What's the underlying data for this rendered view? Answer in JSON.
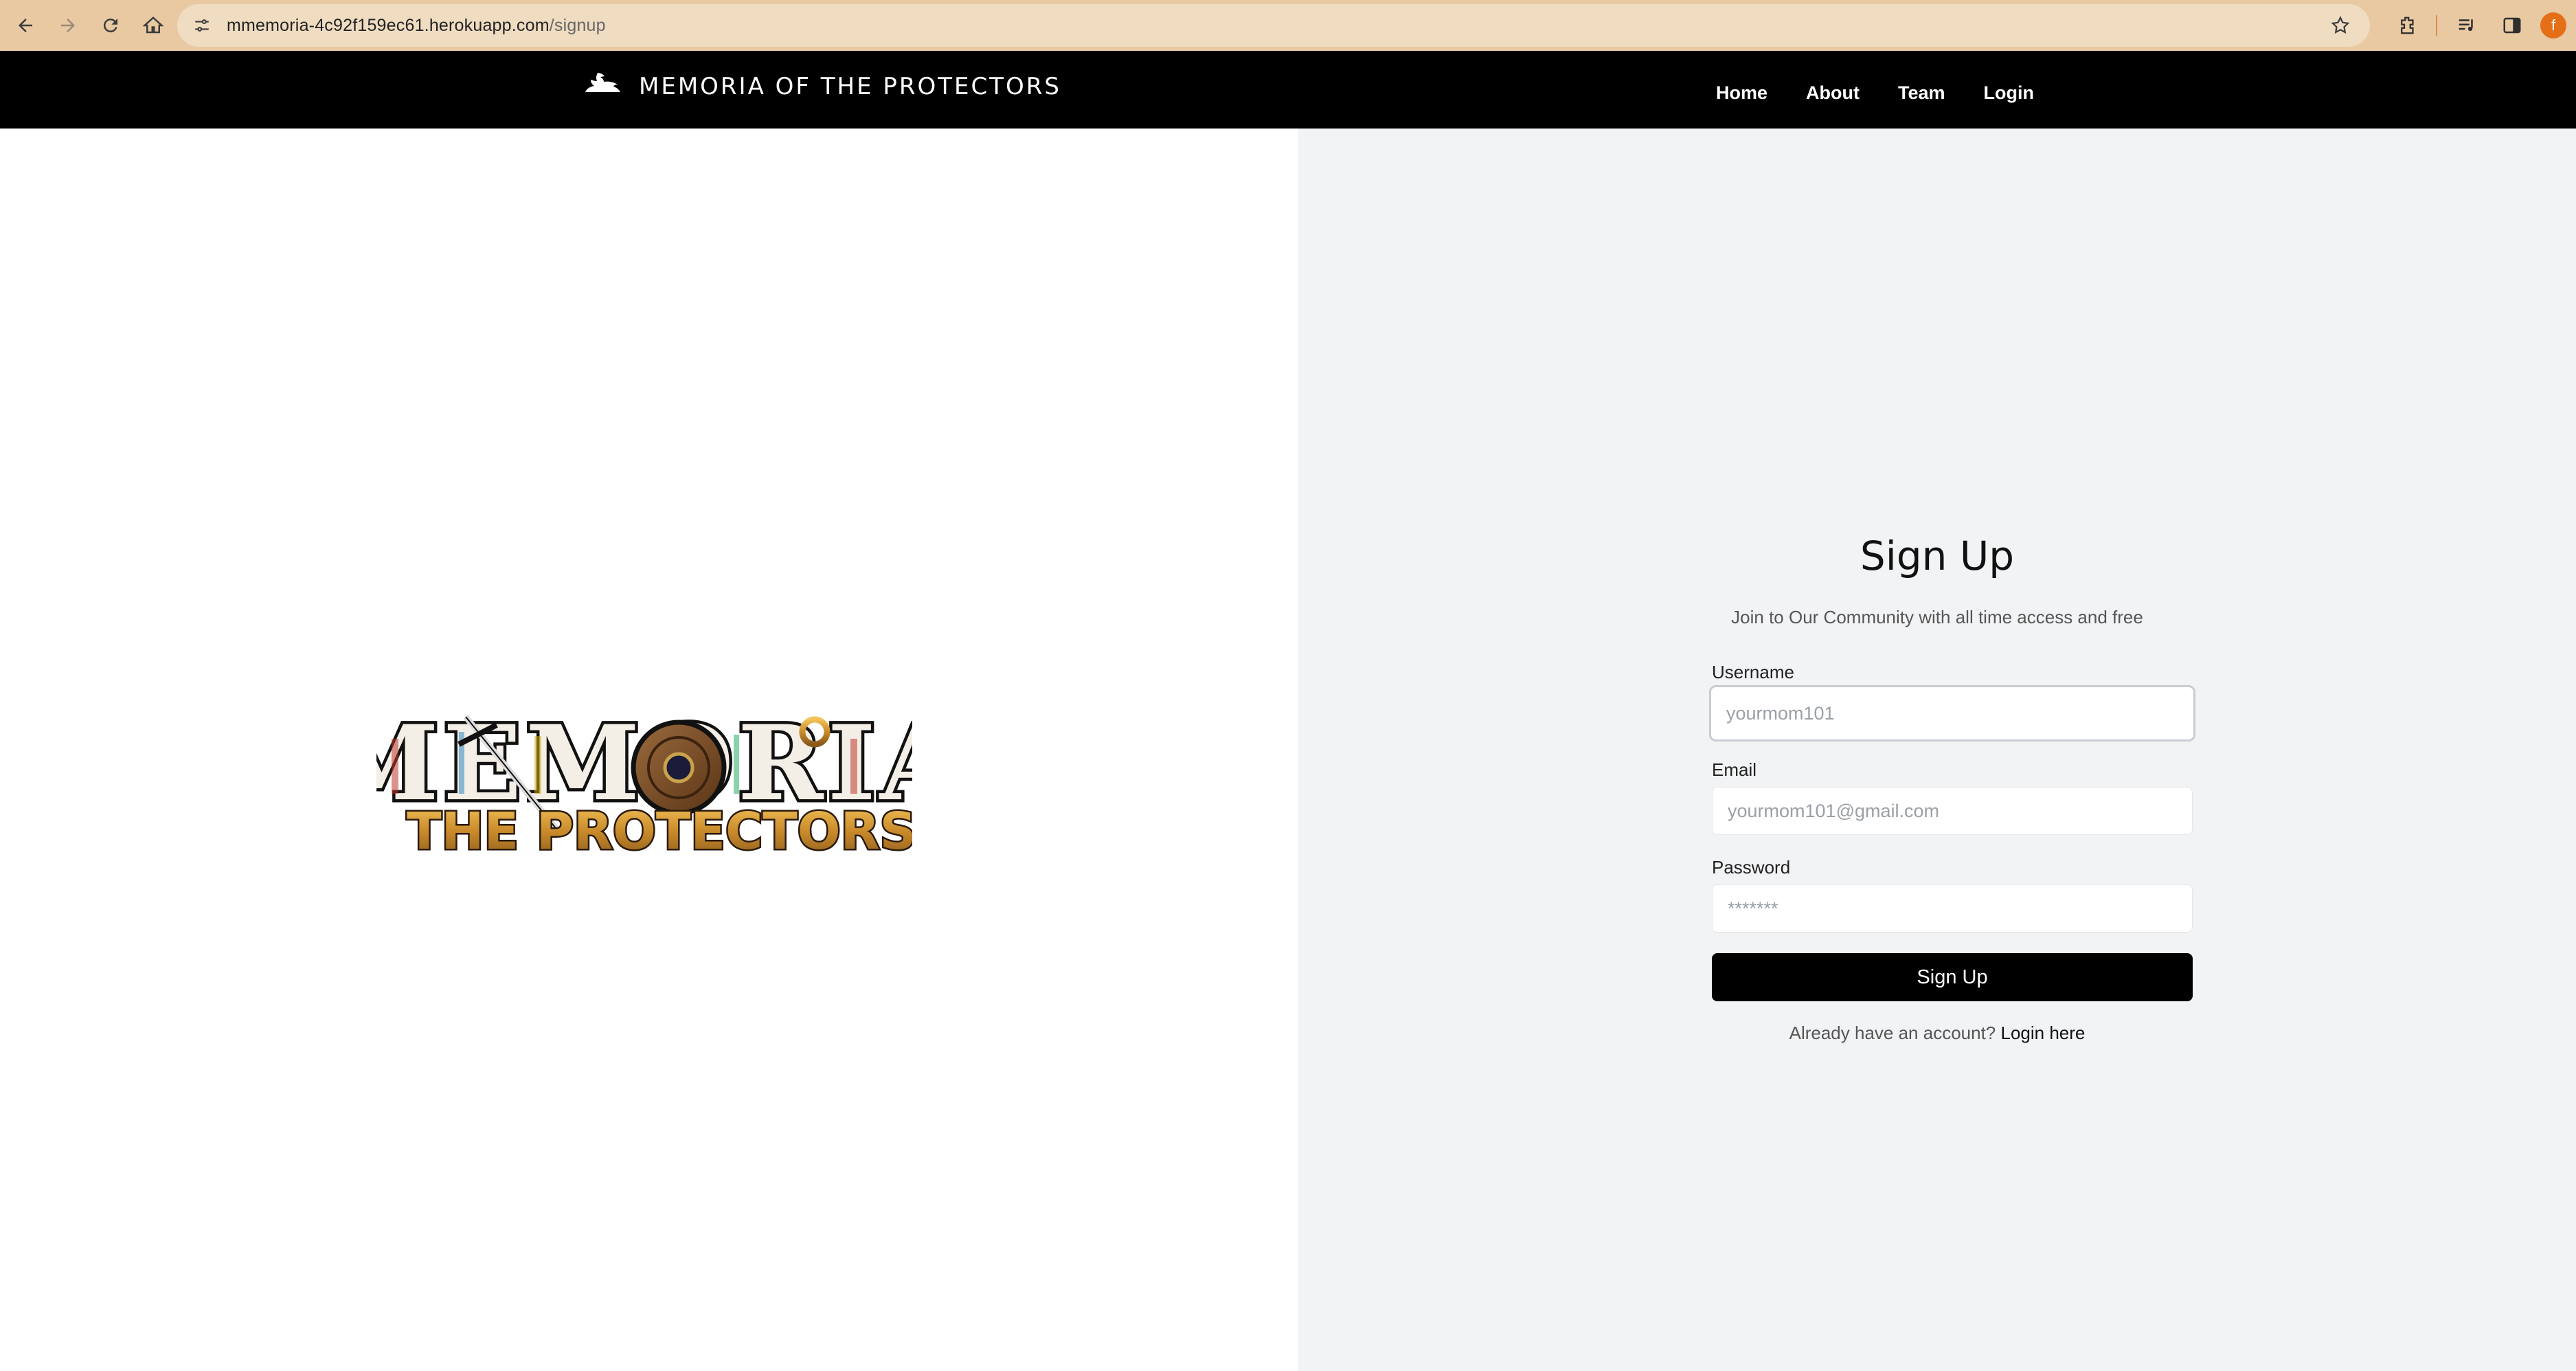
{
  "browser": {
    "url_host": "mmemoria-4c92f159ec61.herokuapp.com",
    "url_path": "/signup",
    "profile_initial": "f",
    "accent_color": "#e8c9a2"
  },
  "header": {
    "brand": "MEMORIA OF THE PROTECTORS",
    "nav": [
      "Home",
      "About",
      "Team",
      "Login"
    ]
  },
  "form": {
    "title": "Sign Up",
    "subtitle": "Join to Our Community with all time access and free",
    "username_label": "Username",
    "username_placeholder": "yourmom101",
    "email_label": "Email",
    "email_placeholder": "yourmom101@gmail.com",
    "password_label": "Password",
    "password_placeholder": "*******",
    "submit_label": "Sign Up",
    "login_prompt": "Already have an account?",
    "login_link": "Login here"
  },
  "logo": {
    "line1": "MEMORIA",
    "line2": "THE PROTECTORS"
  }
}
